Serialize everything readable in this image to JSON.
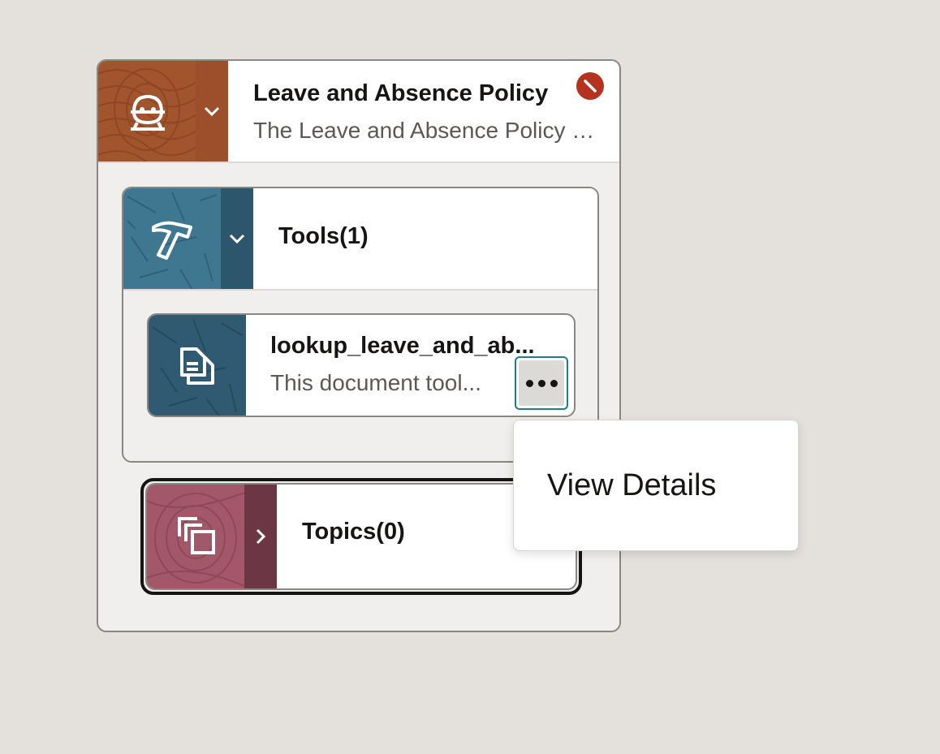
{
  "agent": {
    "title": "Leave and Absence Policy",
    "description": "The Leave and Absence Policy agent",
    "status": "disabled",
    "tile_icon": "agent-robot-icon",
    "toggle_icon": "chevron-down-icon",
    "tile_color": "#a2542d",
    "strip_color": "#9c4f2a"
  },
  "tools": {
    "title": "Tools(1)",
    "tile_icon": "hammer-icon",
    "toggle_icon": "chevron-down-icon",
    "tile_color": "#3f7790",
    "strip_color": "#2d566d",
    "items": [
      {
        "title": "lookup_leave_and_ab...",
        "description": "This document tool...",
        "tile_icon": "document-icon",
        "tile_color": "#2f5a72",
        "more_icon": "more-options-icon"
      }
    ]
  },
  "topics": {
    "title": "Topics(0)",
    "tile_icon": "copy-stack-icon",
    "toggle_icon": "chevron-right-icon",
    "tile_color": "#a25868",
    "strip_color": "#6d3644"
  },
  "popup_menu": {
    "items": [
      {
        "label": "View Details"
      }
    ]
  }
}
